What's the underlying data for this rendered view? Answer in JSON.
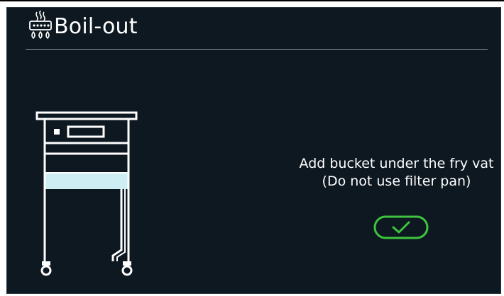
{
  "header": {
    "title": "Boil-out",
    "icon": "boil-out-icon"
  },
  "message": {
    "line1": "Add bucket under the fry vat",
    "line2": "(Do not use filter pan)"
  },
  "confirm_button": {
    "icon": "checkmark-icon",
    "color": "#3ec43e"
  },
  "colors": {
    "background": "#0e1821",
    "highlight": "#cdeff3",
    "text": "#ffffff"
  }
}
